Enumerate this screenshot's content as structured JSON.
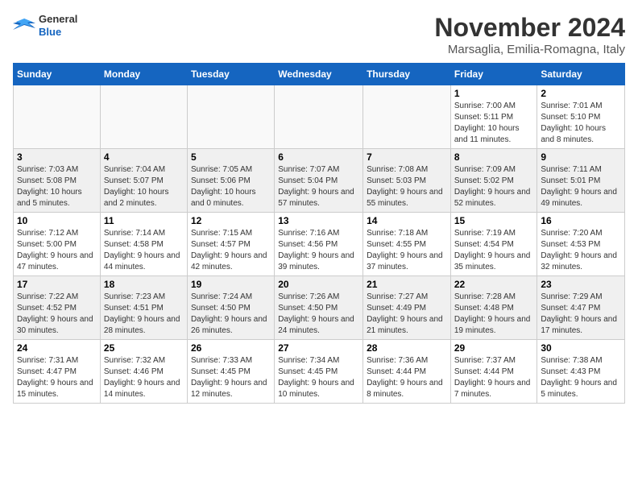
{
  "header": {
    "logo": {
      "general": "General",
      "blue": "Blue"
    },
    "title": "November 2024",
    "location": "Marsaglia, Emilia-Romagna, Italy"
  },
  "weekdays": [
    "Sunday",
    "Monday",
    "Tuesday",
    "Wednesday",
    "Thursday",
    "Friday",
    "Saturday"
  ],
  "weeks": [
    [
      {
        "day": "",
        "info": ""
      },
      {
        "day": "",
        "info": ""
      },
      {
        "day": "",
        "info": ""
      },
      {
        "day": "",
        "info": ""
      },
      {
        "day": "",
        "info": ""
      },
      {
        "day": "1",
        "info": "Sunrise: 7:00 AM\nSunset: 5:11 PM\nDaylight: 10 hours and 11 minutes."
      },
      {
        "day": "2",
        "info": "Sunrise: 7:01 AM\nSunset: 5:10 PM\nDaylight: 10 hours and 8 minutes."
      }
    ],
    [
      {
        "day": "3",
        "info": "Sunrise: 7:03 AM\nSunset: 5:08 PM\nDaylight: 10 hours and 5 minutes."
      },
      {
        "day": "4",
        "info": "Sunrise: 7:04 AM\nSunset: 5:07 PM\nDaylight: 10 hours and 2 minutes."
      },
      {
        "day": "5",
        "info": "Sunrise: 7:05 AM\nSunset: 5:06 PM\nDaylight: 10 hours and 0 minutes."
      },
      {
        "day": "6",
        "info": "Sunrise: 7:07 AM\nSunset: 5:04 PM\nDaylight: 9 hours and 57 minutes."
      },
      {
        "day": "7",
        "info": "Sunrise: 7:08 AM\nSunset: 5:03 PM\nDaylight: 9 hours and 55 minutes."
      },
      {
        "day": "8",
        "info": "Sunrise: 7:09 AM\nSunset: 5:02 PM\nDaylight: 9 hours and 52 minutes."
      },
      {
        "day": "9",
        "info": "Sunrise: 7:11 AM\nSunset: 5:01 PM\nDaylight: 9 hours and 49 minutes."
      }
    ],
    [
      {
        "day": "10",
        "info": "Sunrise: 7:12 AM\nSunset: 5:00 PM\nDaylight: 9 hours and 47 minutes."
      },
      {
        "day": "11",
        "info": "Sunrise: 7:14 AM\nSunset: 4:58 PM\nDaylight: 9 hours and 44 minutes."
      },
      {
        "day": "12",
        "info": "Sunrise: 7:15 AM\nSunset: 4:57 PM\nDaylight: 9 hours and 42 minutes."
      },
      {
        "day": "13",
        "info": "Sunrise: 7:16 AM\nSunset: 4:56 PM\nDaylight: 9 hours and 39 minutes."
      },
      {
        "day": "14",
        "info": "Sunrise: 7:18 AM\nSunset: 4:55 PM\nDaylight: 9 hours and 37 minutes."
      },
      {
        "day": "15",
        "info": "Sunrise: 7:19 AM\nSunset: 4:54 PM\nDaylight: 9 hours and 35 minutes."
      },
      {
        "day": "16",
        "info": "Sunrise: 7:20 AM\nSunset: 4:53 PM\nDaylight: 9 hours and 32 minutes."
      }
    ],
    [
      {
        "day": "17",
        "info": "Sunrise: 7:22 AM\nSunset: 4:52 PM\nDaylight: 9 hours and 30 minutes."
      },
      {
        "day": "18",
        "info": "Sunrise: 7:23 AM\nSunset: 4:51 PM\nDaylight: 9 hours and 28 minutes."
      },
      {
        "day": "19",
        "info": "Sunrise: 7:24 AM\nSunset: 4:50 PM\nDaylight: 9 hours and 26 minutes."
      },
      {
        "day": "20",
        "info": "Sunrise: 7:26 AM\nSunset: 4:50 PM\nDaylight: 9 hours and 24 minutes."
      },
      {
        "day": "21",
        "info": "Sunrise: 7:27 AM\nSunset: 4:49 PM\nDaylight: 9 hours and 21 minutes."
      },
      {
        "day": "22",
        "info": "Sunrise: 7:28 AM\nSunset: 4:48 PM\nDaylight: 9 hours and 19 minutes."
      },
      {
        "day": "23",
        "info": "Sunrise: 7:29 AM\nSunset: 4:47 PM\nDaylight: 9 hours and 17 minutes."
      }
    ],
    [
      {
        "day": "24",
        "info": "Sunrise: 7:31 AM\nSunset: 4:47 PM\nDaylight: 9 hours and 15 minutes."
      },
      {
        "day": "25",
        "info": "Sunrise: 7:32 AM\nSunset: 4:46 PM\nDaylight: 9 hours and 14 minutes."
      },
      {
        "day": "26",
        "info": "Sunrise: 7:33 AM\nSunset: 4:45 PM\nDaylight: 9 hours and 12 minutes."
      },
      {
        "day": "27",
        "info": "Sunrise: 7:34 AM\nSunset: 4:45 PM\nDaylight: 9 hours and 10 minutes."
      },
      {
        "day": "28",
        "info": "Sunrise: 7:36 AM\nSunset: 4:44 PM\nDaylight: 9 hours and 8 minutes."
      },
      {
        "day": "29",
        "info": "Sunrise: 7:37 AM\nSunset: 4:44 PM\nDaylight: 9 hours and 7 minutes."
      },
      {
        "day": "30",
        "info": "Sunrise: 7:38 AM\nSunset: 4:43 PM\nDaylight: 9 hours and 5 minutes."
      }
    ]
  ]
}
